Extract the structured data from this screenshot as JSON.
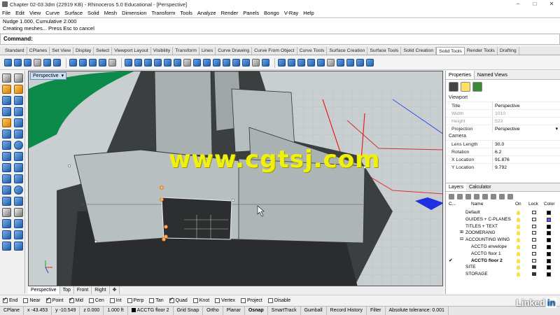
{
  "window": {
    "title": "Chapter 02-03.3dm (22919 KB) - Rhinoceros 5.0 Educational - [Perspective]"
  },
  "menu": [
    "File",
    "Edit",
    "View",
    "Curve",
    "Surface",
    "Solid",
    "Mesh",
    "Dimension",
    "Transform",
    "Tools",
    "Analyze",
    "Render",
    "Panels",
    "Bongo",
    "V-Ray",
    "Help"
  ],
  "command_history": [
    "Nudge 1.000, Cumulative 2.000",
    "Creating meshes... Press Esc to cancel"
  ],
  "command_prompt": "Command:",
  "toolbar_tabs": [
    "Standard",
    "CPlanes",
    "Set View",
    "Display",
    "Select",
    "Viewport Layout",
    "Visibility",
    "Transform",
    "Lines",
    "Curve Drawing",
    "Curve From Object",
    "Curve Tools",
    "Surface Creation",
    "Surface Tools",
    "Solid Creation",
    "Solid Tools",
    "Render Tools",
    "Drafting"
  ],
  "active_toolbar_tab": "Solid Tools",
  "viewport": {
    "label": "Perspective",
    "watermark": "www.cgtsj.com",
    "tabs": [
      "Perspective",
      "Top",
      "Front",
      "Right"
    ]
  },
  "properties": {
    "tabs": [
      "Properties",
      "Named Views"
    ],
    "section": "Viewport",
    "rows": [
      {
        "k": "Title",
        "v": "Perspective",
        "dim": false
      },
      {
        "k": "Width",
        "v": "1010",
        "dim": true
      },
      {
        "k": "Height",
        "v": "523",
        "dim": true
      },
      {
        "k": "Projection",
        "v": "Perspective",
        "dim": false
      }
    ],
    "camera_section": "Camera",
    "camera_rows": [
      {
        "k": "Lens Length",
        "v": "30.0"
      },
      {
        "k": "Rotation",
        "v": "6.2"
      },
      {
        "k": "X Location",
        "v": "91.876"
      },
      {
        "k": "Y Location",
        "v": "9.792"
      }
    ]
  },
  "layers": {
    "tabs": [
      "Layers",
      "Calculator"
    ],
    "headers": {
      "c": "C...",
      "name": "Name",
      "on": "On",
      "lock": "Lock",
      "color": "Color"
    },
    "rows": [
      {
        "name": "Default",
        "indent": 0,
        "locked": false,
        "color": "#000000",
        "current": false,
        "expand": ""
      },
      {
        "name": "GUIDES + C-PLANES",
        "indent": 0,
        "locked": false,
        "color": "#5a5aff",
        "current": false,
        "expand": ""
      },
      {
        "name": "TITLES + TEXT",
        "indent": 0,
        "locked": false,
        "color": "#000000",
        "current": false,
        "expand": ""
      },
      {
        "name": "ZOOMERANG",
        "indent": 0,
        "locked": false,
        "color": "#000000",
        "current": false,
        "expand": "⊞"
      },
      {
        "name": "ACCOUNTING WING",
        "indent": 0,
        "locked": false,
        "color": "#000000",
        "current": false,
        "expand": "⊟"
      },
      {
        "name": "ACCTG envelope",
        "indent": 1,
        "locked": false,
        "color": "#000000",
        "current": false,
        "expand": ""
      },
      {
        "name": "ACCTG floor 1",
        "indent": 1,
        "locked": false,
        "color": "#000000",
        "current": false,
        "expand": ""
      },
      {
        "name": "ACCTG floor 2",
        "indent": 1,
        "locked": false,
        "color": "#000000",
        "current": true,
        "expand": ""
      },
      {
        "name": "SITE",
        "indent": 0,
        "locked": true,
        "color": "#000000",
        "current": false,
        "expand": ""
      },
      {
        "name": "STORAGE",
        "indent": 0,
        "locked": true,
        "color": "#000000",
        "current": false,
        "expand": ""
      }
    ]
  },
  "osnaps": [
    {
      "label": "End",
      "on": true
    },
    {
      "label": "Near",
      "on": false
    },
    {
      "label": "Point",
      "on": true
    },
    {
      "label": "Mid",
      "on": true
    },
    {
      "label": "Cen",
      "on": false
    },
    {
      "label": "Int",
      "on": false
    },
    {
      "label": "Perp",
      "on": false
    },
    {
      "label": "Tan",
      "on": false
    },
    {
      "label": "Quad",
      "on": true
    },
    {
      "label": "Knot",
      "on": false
    },
    {
      "label": "Vertex",
      "on": false
    },
    {
      "label": "Project",
      "on": false
    },
    {
      "label": "Disable",
      "on": false
    }
  ],
  "status": {
    "cplane": "CPlane",
    "x": "x -43.453",
    "y": "y -10.549",
    "z": "z 0.000",
    "units": "1.000 ft",
    "layer": "ACCTG floor 2",
    "toggles": [
      {
        "label": "Grid Snap",
        "bold": false
      },
      {
        "label": "Ortho",
        "bold": false
      },
      {
        "label": "Planar",
        "bold": false
      },
      {
        "label": "Osnap",
        "bold": true
      },
      {
        "label": "SmartTrack",
        "bold": false
      },
      {
        "label": "Gumball",
        "bold": false
      },
      {
        "label": "Record History",
        "bold": false
      },
      {
        "label": "Filter",
        "bold": false
      }
    ],
    "tolerance": "Absolute tolerance: 0.001"
  },
  "brand": "Linked"
}
